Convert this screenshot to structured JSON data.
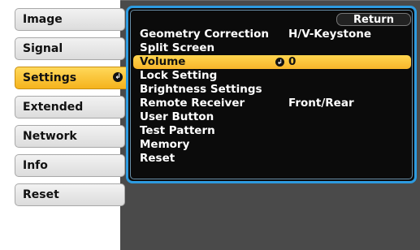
{
  "sidebar": {
    "items": [
      {
        "label": "Image"
      },
      {
        "label": "Signal"
      },
      {
        "label": "Settings",
        "active": true
      },
      {
        "label": "Extended"
      },
      {
        "label": "Network"
      },
      {
        "label": "Info"
      },
      {
        "label": "Reset"
      }
    ],
    "enter_glyph": "↲"
  },
  "panel": {
    "return_label": "Return",
    "rows": [
      {
        "label": "Geometry Correction",
        "value": "H/V-Keystone"
      },
      {
        "label": "Split Screen",
        "value": ""
      },
      {
        "label": "Volume",
        "value": "0",
        "selected": true,
        "icon": "enter-icon"
      },
      {
        "label": "Lock Setting",
        "value": ""
      },
      {
        "label": "Brightness Settings",
        "value": ""
      },
      {
        "label": "Remote Receiver",
        "value": "Front/Rear"
      },
      {
        "label": "User Button",
        "value": ""
      },
      {
        "label": "Test Pattern",
        "value": ""
      },
      {
        "label": "Memory",
        "value": ""
      },
      {
        "label": "Reset",
        "value": ""
      }
    ],
    "row_enter_glyph": "↲"
  },
  "colors": {
    "accent_blue": "#2d9be0",
    "highlight_yellow": "#f7b52a",
    "panel_bg": "#0b0b0b",
    "outer_bg": "#4a4a4a"
  }
}
